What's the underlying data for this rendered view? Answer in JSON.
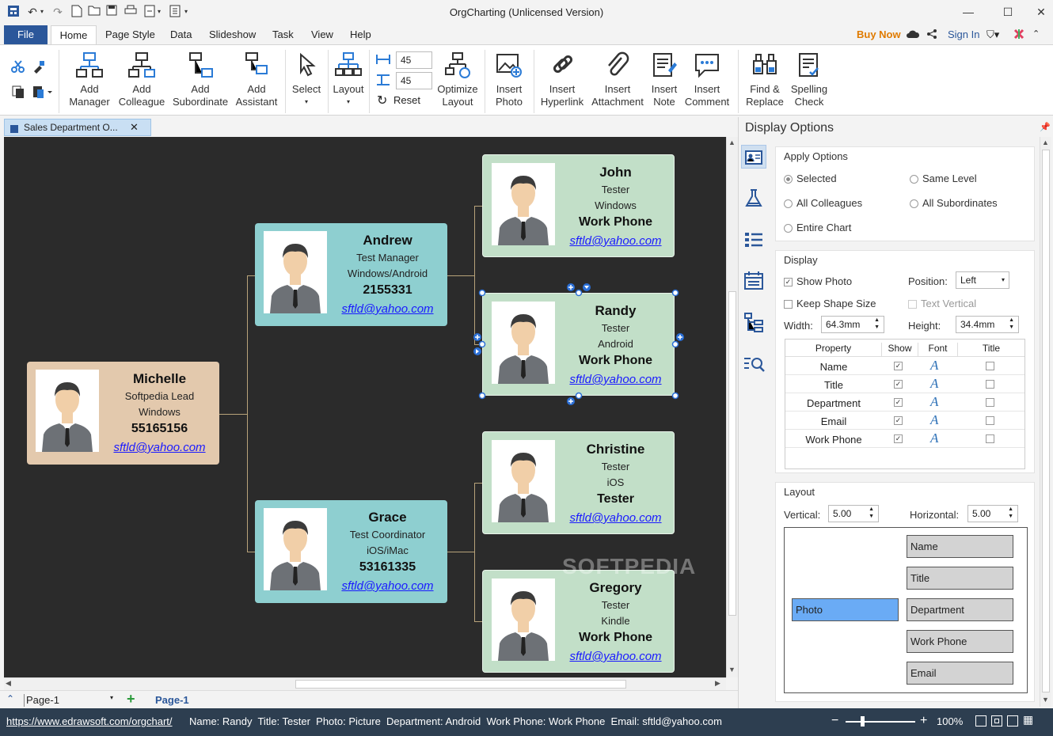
{
  "window": {
    "title": "OrgCharting (Unlicensed Version)"
  },
  "menu": {
    "tabs": [
      "File",
      "Home",
      "Page Style",
      "Data",
      "Slideshow",
      "Task",
      "View",
      "Help"
    ],
    "buy_now": "Buy Now",
    "sign_in": "Sign In"
  },
  "ribbon": {
    "add_manager": [
      "Add",
      "Manager"
    ],
    "add_colleague": [
      "Add",
      "Colleague"
    ],
    "add_subordinate": [
      "Add",
      "Subordinate"
    ],
    "add_assistant": [
      "Add",
      "Assistant"
    ],
    "select": "Select",
    "layout": "Layout",
    "spacing_h": "45",
    "spacing_v": "45",
    "reset": "Reset",
    "optimize_layout": [
      "Optimize",
      "Layout"
    ],
    "insert_photo": [
      "Insert",
      "Photo"
    ],
    "insert_hyperlink": [
      "Insert",
      "Hyperlink"
    ],
    "insert_attachment": [
      "Insert",
      "Attachment"
    ],
    "insert_note": [
      "Insert",
      "Note"
    ],
    "insert_comment": [
      "Insert",
      "Comment"
    ],
    "find_replace": [
      "Find &",
      "Replace"
    ],
    "spelling_check": [
      "Spelling",
      "Check"
    ]
  },
  "document_tab": "Sales Department O...",
  "cards": {
    "michelle": {
      "name": "Michelle",
      "title": "Softpedia Lead",
      "dept": "Windows",
      "phone": "55165156",
      "email": "sftld@yahoo.com"
    },
    "andrew": {
      "name": "Andrew",
      "title": "Test Manager",
      "dept": "Windows/Android",
      "phone": "2155331",
      "email": "sftld@yahoo.com"
    },
    "grace": {
      "name": "Grace",
      "title": "Test Coordinator",
      "dept": "iOS/iMac",
      "phone": "53161335",
      "email": "sftld@yahoo.com"
    },
    "john": {
      "name": "John",
      "title": "Tester",
      "dept": "Windows",
      "phone": "Work Phone",
      "email": "sftld@yahoo.com"
    },
    "randy": {
      "name": "Randy",
      "title": "Tester",
      "dept": "Android",
      "phone": "Work Phone",
      "email": "sftld@yahoo.com"
    },
    "christine": {
      "name": "Christine",
      "title": "Tester",
      "dept": "iOS",
      "phone": "Tester",
      "email": "sftld@yahoo.com"
    },
    "gregory": {
      "name": "Gregory",
      "title": "Tester",
      "dept": "Kindle",
      "phone": "Work Phone",
      "email": "sftld@yahoo.com"
    }
  },
  "watermark": "SOFTPEDIA",
  "panel": {
    "title": "Display Options",
    "apply_options": "Apply Options",
    "radio_selected": "Selected",
    "radio_same_level": "Same Level",
    "radio_all_colleagues": "All Colleagues",
    "radio_all_subordinates": "All Subordinates",
    "radio_entire_chart": "Entire Chart",
    "display": "Display",
    "show_photo": "Show Photo",
    "position_label": "Position:",
    "position_value": "Left",
    "keep_shape_size": "Keep Shape Size",
    "text_vertical": "Text Vertical",
    "width_label": "Width:",
    "width_value": "64.3mm",
    "height_label": "Height:",
    "height_value": "34.4mm",
    "table_headers": [
      "Property",
      "Show",
      "Font",
      "Title"
    ],
    "rows": [
      "Name",
      "Title",
      "Department",
      "Email",
      "Work Phone"
    ],
    "font_glyph": "A",
    "layout": "Layout",
    "vertical_label": "Vertical:",
    "vertical_value": "5.00",
    "horizontal_label": "Horizontal:",
    "horizontal_value": "5.00",
    "preview_photo": "Photo",
    "preview_fields": [
      "Name",
      "Title",
      "Department",
      "Work Phone",
      "Email"
    ]
  },
  "pagebar": {
    "page_select": "Page-1",
    "page_tab": "Page-1"
  },
  "status": {
    "url": "https://www.edrawsoft.com/orgchart/",
    "info": "Name: Randy  Title: Tester  Photo: Picture  Department: Android  Work Phone: Work Phone  Email: sftld@yahoo.com",
    "zoom": "100%"
  },
  "colors": {
    "accent": "#2b579a",
    "root": "#e3c9ad",
    "manager": "#8ecfd0",
    "leaf": "#c2dfc8",
    "canvas": "#2b2b2b",
    "buy": "#e07b00"
  }
}
